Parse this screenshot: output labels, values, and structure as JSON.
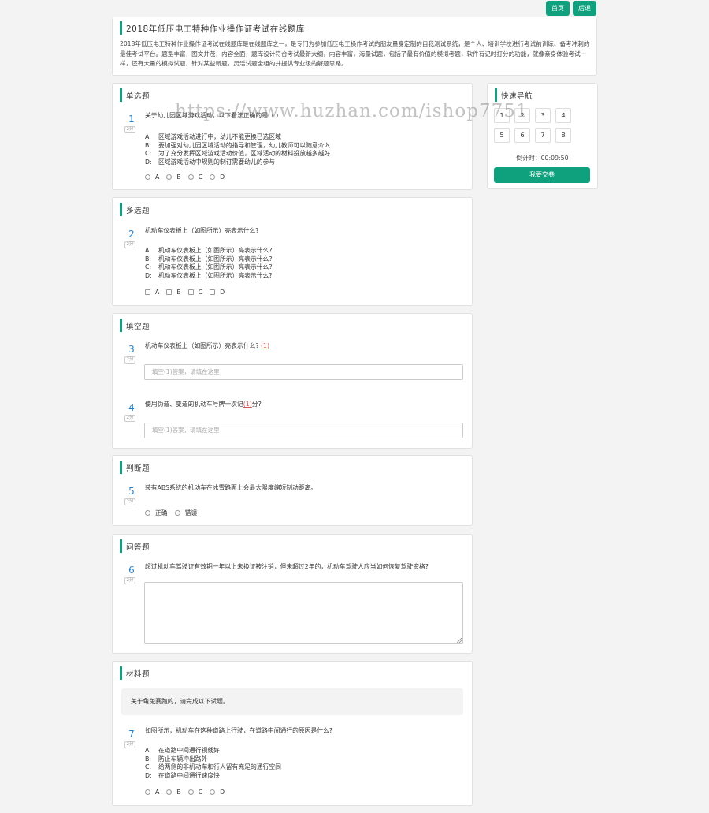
{
  "header": {
    "home_label": "首页",
    "back_label": "后退"
  },
  "intro": {
    "title": "2018年低压电工特种作业操作证考试在线题库",
    "description": "2018年低压电工特种作业操作证考试在线题库是在线题库之一，是专门为参加低压电工操作考试的朋友量身定制的自我测试系统，是个人、培训学校进行考试前训练、备考冲刺的最佳考试平台。题型丰富，图文并茂，内容全面，题库设计符合考试最新大纲，内容丰富，海量试题，包括了最有价值的模拟考题，软件有记时打分的功能，就像亲身体验考试一样，还有大量的模拟试题，针对某些新题，灵活试题全组的并提供专业级的解题思路。"
  },
  "sections": {
    "single": {
      "title": "单选题",
      "q1": {
        "num": "1",
        "score": "2分",
        "text": "关于幼儿园区域游戏活动，以下看法正确的是（ ）",
        "options": [
          {
            "letter": "A:",
            "text": "区域游戏活动进行中，幼儿不能更换已选区域"
          },
          {
            "letter": "B:",
            "text": "要加强对幼儿园区域活动的指导和管理，幼儿教师可以随意介入"
          },
          {
            "letter": "C:",
            "text": "为了充分发挥区域游戏活动价值，区域活动的材料投放越多越好"
          },
          {
            "letter": "D:",
            "text": "区域游戏活动中规则的制订需要幼儿的参与"
          }
        ],
        "choices": [
          "A",
          "B",
          "C",
          "D"
        ]
      }
    },
    "multi": {
      "title": "多选题",
      "q2": {
        "num": "2",
        "score": "2分",
        "text": "机动车仪表板上（如图所示）亮表示什么?",
        "options": [
          {
            "letter": "A:",
            "text": "机动车仪表板上（如图所示）亮表示什么?"
          },
          {
            "letter": "B:",
            "text": "机动车仪表板上（如图所示）亮表示什么?"
          },
          {
            "letter": "C:",
            "text": "机动车仪表板上（如图所示）亮表示什么?"
          },
          {
            "letter": "D:",
            "text": "机动车仪表板上（如图所示）亮表示什么?"
          }
        ],
        "choices": [
          "A",
          "B",
          "C",
          "D"
        ]
      }
    },
    "fill": {
      "title": "填空题",
      "q3": {
        "num": "3",
        "score": "2分",
        "text": "机动车仪表板上（如图所示）亮表示什么?",
        "blank": "(1)",
        "placeholder": "填空(1)答案，请填在这里"
      },
      "q4": {
        "num": "4",
        "score": "2分",
        "text_before": "使用伪造、变造的机动车号牌一次记",
        "blank": "(1)",
        "text_after": "分?",
        "placeholder": "填空(1)答案，请填在这里"
      }
    },
    "judge": {
      "title": "判断题",
      "q5": {
        "num": "5",
        "score": "2分",
        "text": "装有ABS系统的机动车在冰雪路面上会最大限度缩短制动距离。",
        "choices": [
          "正确",
          "错误"
        ]
      }
    },
    "essay": {
      "title": "问答题",
      "q6": {
        "num": "6",
        "score": "2分",
        "text": "超过机动车驾驶证有效期一年以上未换证被注销，但未超过2年的，机动车驾驶人应当如何恢复驾驶资格?"
      }
    },
    "material": {
      "title": "材料题",
      "material_text": "关于龟兔赛跑的，请完成以下试题。",
      "q7": {
        "num": "7",
        "score": "2分",
        "text": "如图所示，机动车在这种道路上行驶，在道路中间通行的原因是什么?",
        "options": [
          {
            "letter": "A:",
            "text": "在道路中间通行视线好"
          },
          {
            "letter": "B:",
            "text": "防止车辆冲出路外"
          },
          {
            "letter": "C:",
            "text": "给两侧的非机动车和行人留有充足的通行空间"
          },
          {
            "letter": "D:",
            "text": "在道路中间通行速度快"
          }
        ],
        "choices": [
          "A",
          "B",
          "C",
          "D"
        ]
      }
    }
  },
  "nav": {
    "title": "快速导航",
    "items": [
      "1",
      "2",
      "3",
      "4",
      "5",
      "6",
      "7",
      "8"
    ],
    "timer": "倒计时：00:09:50",
    "submit_label": "我要交卷"
  },
  "watermark": "https://www.huzhan.com/ishop7751"
}
